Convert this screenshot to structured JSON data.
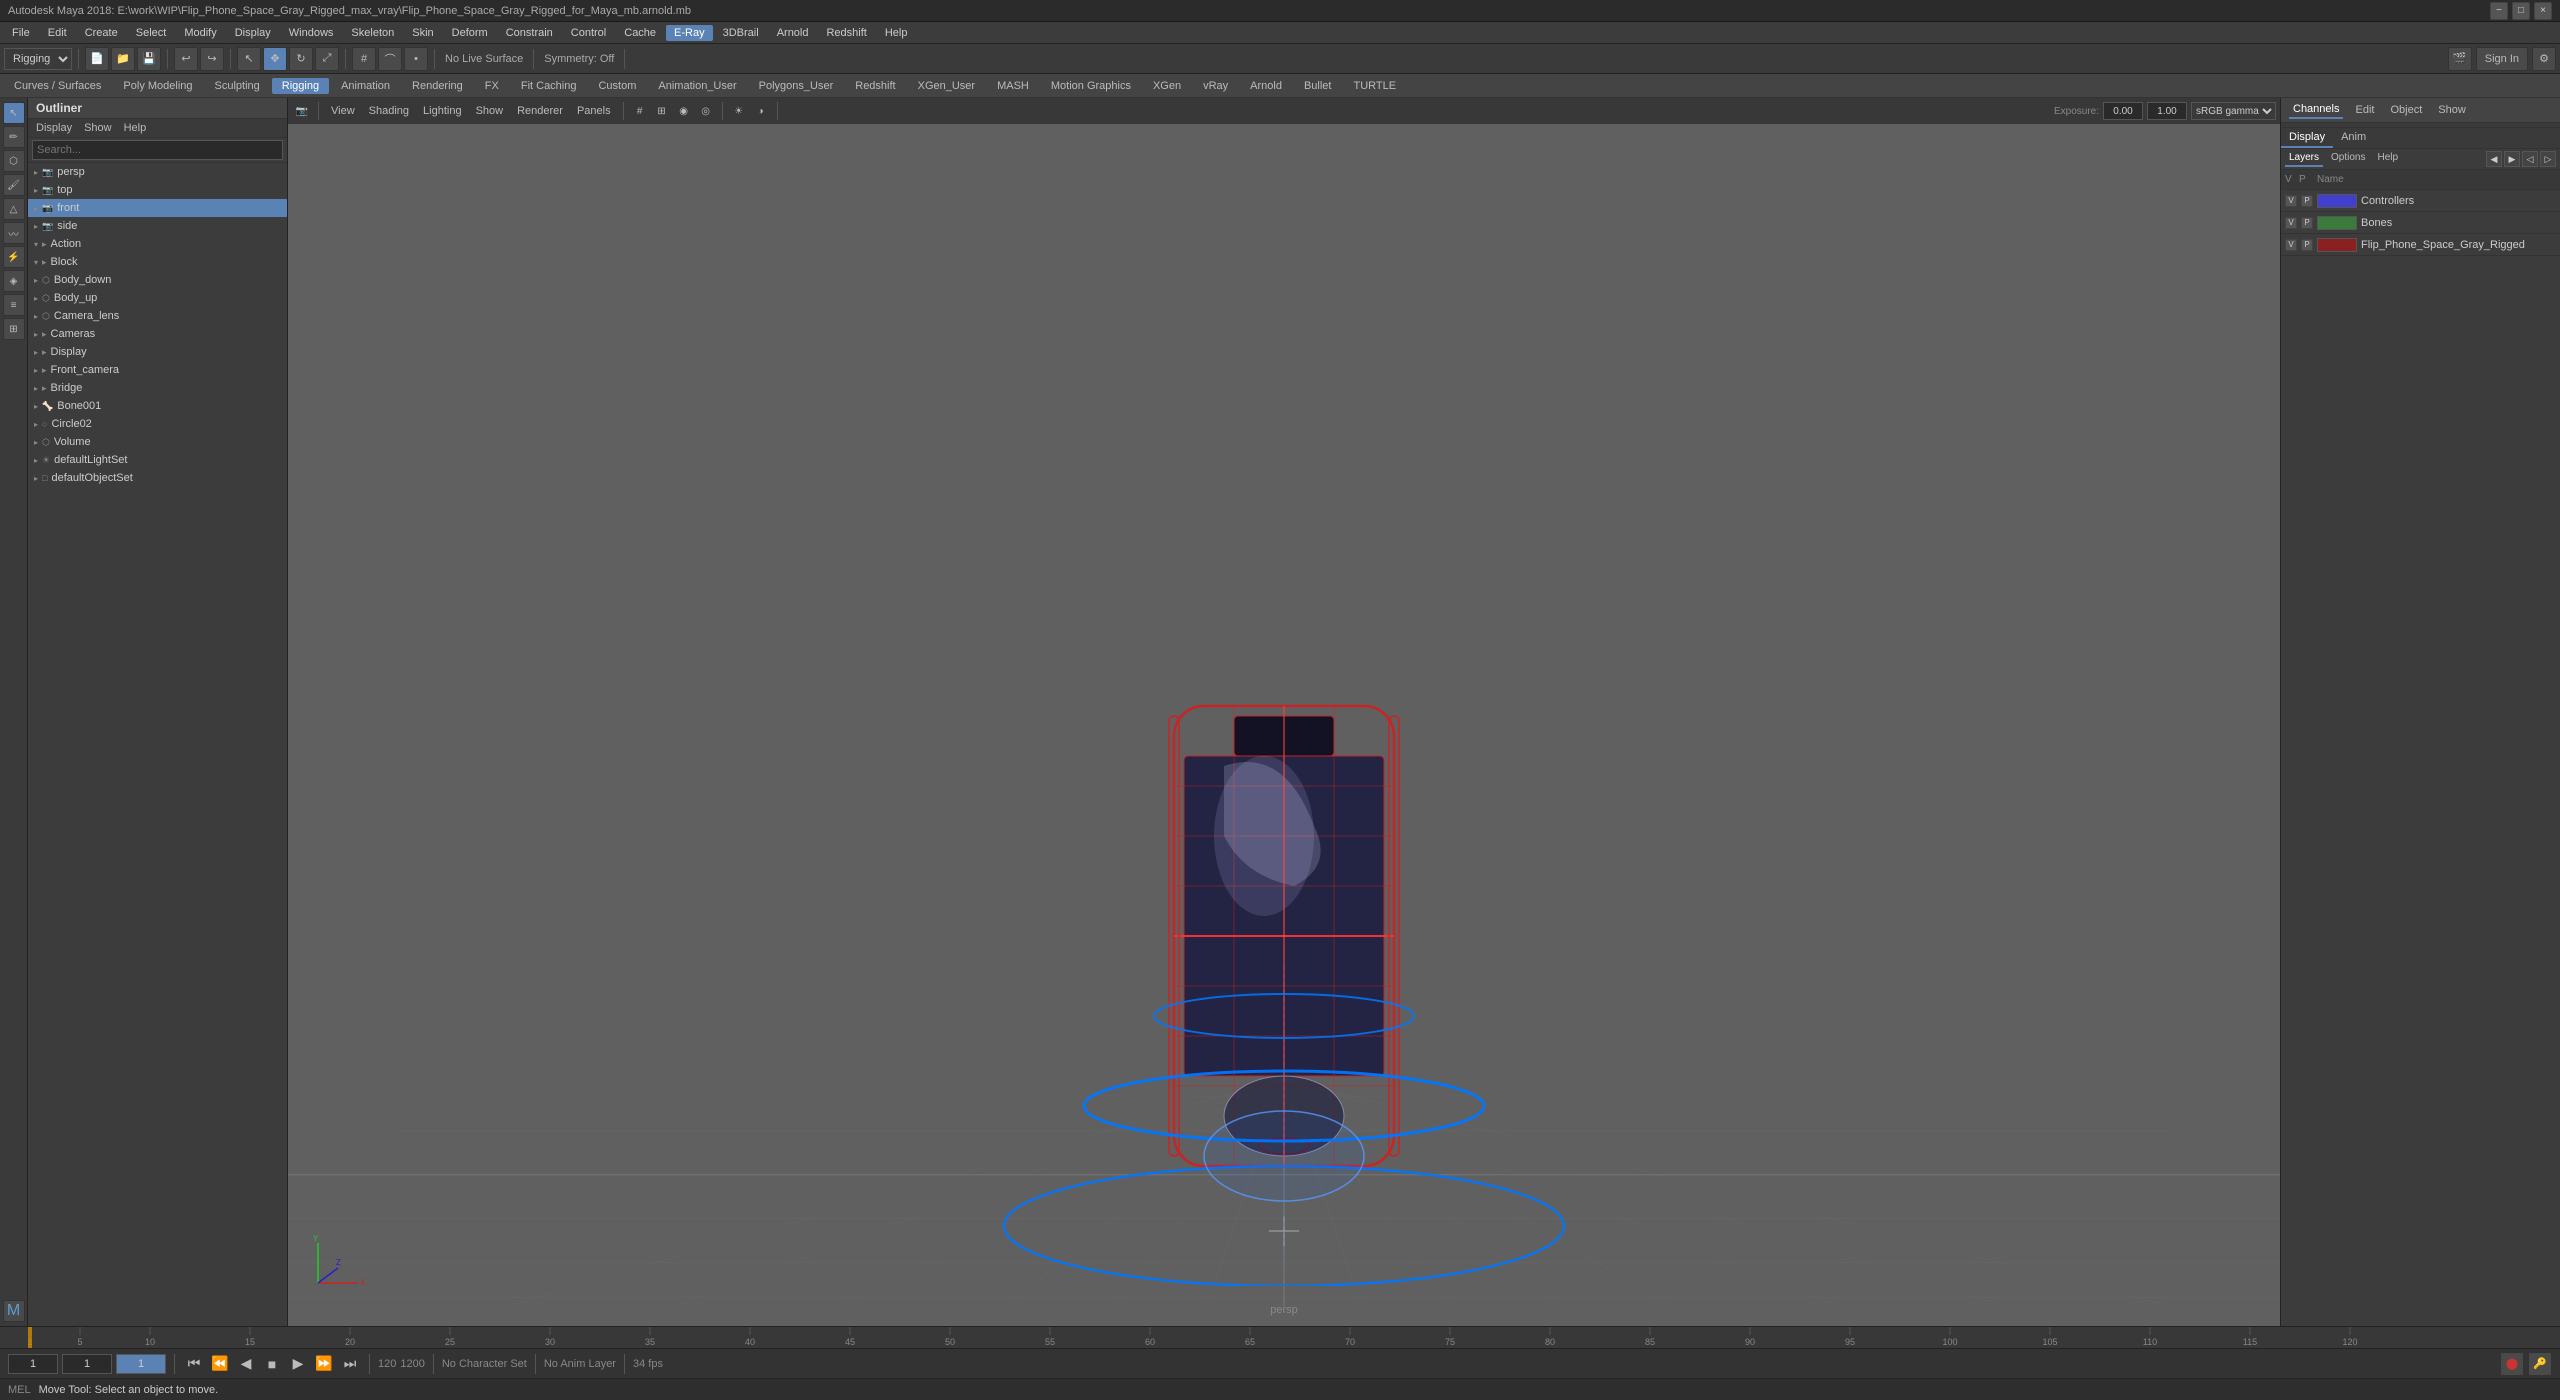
{
  "window": {
    "title": "Autodesk Maya 2018: E:\\work\\WIP\\Flip_Phone_Space_Gray_Rigged_max_vray\\Flip_Phone_Space_Gray_Rigged_for_Maya_mb.arnold.mb"
  },
  "menu": {
    "items": [
      "File",
      "Edit",
      "Create",
      "Select",
      "Modify",
      "Display",
      "Windows",
      "Skeleton",
      "Skin",
      "Deform",
      "Constrain",
      "Control",
      "Cache",
      "E-Ray",
      "3DBrail",
      "Arnold",
      "Redshift",
      "Help"
    ]
  },
  "toolbar": {
    "mode_select": "Rigging",
    "symmetry": "Symmetry: Off",
    "no_live_surface": "No Live Surface",
    "sign_in": "Sign In"
  },
  "module_bar": {
    "tabs": [
      "Curves / Surfaces",
      "Poly Modeling",
      "Sculpting",
      "Rigging",
      "Animation",
      "Rendering",
      "FX",
      "Fit Caching",
      "Custom",
      "Animation_User",
      "Polygons_User",
      "Redshift",
      "XGen_User",
      "MASH",
      "Motion Graphics",
      "XGen",
      "vRay",
      "Arnold",
      "Bullet",
      "TURTLE"
    ]
  },
  "outliner": {
    "title": "Outliner",
    "menu_items": [
      "Display",
      "Show",
      "Help"
    ],
    "search_placeholder": "Search...",
    "items": [
      {
        "id": "item1",
        "label": "persp",
        "icon": "camera",
        "indent": 0,
        "expanded": false
      },
      {
        "id": "item2",
        "label": "top",
        "icon": "camera",
        "indent": 0,
        "expanded": false
      },
      {
        "id": "item3",
        "label": "front",
        "icon": "camera",
        "indent": 0,
        "expanded": false,
        "selected": true
      },
      {
        "id": "item4",
        "label": "side",
        "icon": "camera",
        "indent": 0,
        "expanded": false
      },
      {
        "id": "item5",
        "label": "Action",
        "icon": "group",
        "indent": 0,
        "expanded": true
      },
      {
        "id": "item6",
        "label": "Block",
        "icon": "group",
        "indent": 0,
        "expanded": true
      },
      {
        "id": "item7",
        "label": "Body_down",
        "icon": "mesh",
        "indent": 0,
        "expanded": false
      },
      {
        "id": "item8",
        "label": "Body_up",
        "icon": "mesh",
        "indent": 0,
        "expanded": false
      },
      {
        "id": "item9",
        "label": "Camera_lens",
        "icon": "mesh",
        "indent": 0,
        "expanded": false
      },
      {
        "id": "item10",
        "label": "Cameras",
        "icon": "group",
        "indent": 0,
        "expanded": false
      },
      {
        "id": "item11",
        "label": "Display",
        "icon": "group",
        "indent": 0,
        "expanded": false
      },
      {
        "id": "item12",
        "label": "Front_camera",
        "icon": "group",
        "indent": 0,
        "expanded": false
      },
      {
        "id": "item13",
        "label": "Bridge",
        "icon": "group",
        "indent": 0,
        "expanded": false
      },
      {
        "id": "item14",
        "label": "Bone001",
        "icon": "bone",
        "indent": 0,
        "expanded": false
      },
      {
        "id": "item15",
        "label": "Circle02",
        "icon": "curve",
        "indent": 0,
        "expanded": false
      },
      {
        "id": "item16",
        "label": "Volume",
        "icon": "mesh",
        "indent": 0,
        "expanded": false
      },
      {
        "id": "item17",
        "label": "defaultLightSet",
        "icon": "lightset",
        "indent": 0,
        "expanded": false
      },
      {
        "id": "item18",
        "label": "defaultObjectSet",
        "icon": "objectset",
        "indent": 0,
        "expanded": false
      }
    ]
  },
  "viewport": {
    "menus": [
      "View",
      "Shading",
      "Lighting",
      "Show",
      "Renderer",
      "Panels"
    ],
    "label": "persp",
    "gamma_label": "sRGB gamma",
    "gamma_value": "1.00",
    "exposure_value": "0.00"
  },
  "right_panel": {
    "tabs": [
      "Channels",
      "Edit",
      "Object",
      "Show"
    ],
    "sub_tabs": [
      "Display",
      "Anim"
    ],
    "layer_sub_tabs": [
      "Layers",
      "Options",
      "Help"
    ],
    "layers": [
      {
        "v": "V",
        "p": "P",
        "name": "Controllers",
        "color": "#4040cc"
      },
      {
        "v": "V",
        "p": "P",
        "name": "Bones",
        "color": "#3a7a3a"
      },
      {
        "v": "V",
        "p": "P",
        "name": "Flip_Phone_Space_Gray_Rigged",
        "color": "#8b2020"
      }
    ]
  },
  "timeline": {
    "start": 1,
    "end": 120,
    "current": 1,
    "playback_end": 120,
    "playback_end2": 1200,
    "fps": "34 fps"
  },
  "status_bar": {
    "mode": "MEL",
    "message": "Move Tool: Select an object to move.",
    "no_character_set": "No Character Set",
    "no_anim_layer": "No Anim Layer",
    "fps": "34 fps"
  },
  "icons": {
    "arrow": "▶",
    "arrow_left": "◀",
    "play": "▶",
    "stop": "■",
    "rewind": "⏮",
    "fast_forward": "⏭",
    "step_back": "⏪",
    "step_forward": "⏩",
    "gear": "⚙",
    "search": "🔍",
    "expand": "▸",
    "collapse": "▾",
    "chevron_down": "▼",
    "chevron_right": "▶",
    "minus": "−",
    "plus": "+",
    "close": "×"
  }
}
